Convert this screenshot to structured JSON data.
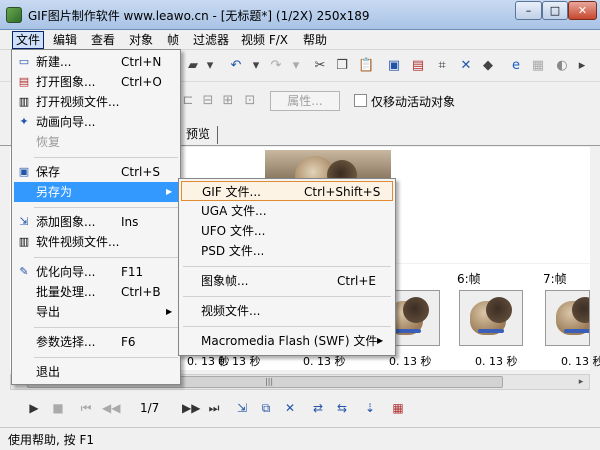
{
  "window": {
    "title": "GIF图片制作软件 www.leawo.cn - [无标题*] (1/2X)  250x189",
    "minimize": "–",
    "maximize": "□",
    "close": "✕"
  },
  "menubar": [
    "文件",
    "编辑",
    "查看",
    "对象",
    "帧",
    "过滤器",
    "视频 F/X",
    "帮助"
  ],
  "toolbar": {
    "icons": [
      "dropdown-arrow-icon",
      "undo-icon",
      "undo-dropdown-icon",
      "redo-icon",
      "redo-dropdown-icon",
      "cut-icon",
      "copy-icon",
      "paste-icon",
      "save-icon",
      "image-icon",
      "crop-icon",
      "resize-icon",
      "object-icon",
      "browser-icon",
      "disabled-icon",
      "sound-icon"
    ]
  },
  "toolbar2": {
    "properties_button": "属性...",
    "checkbox_label": "仅移动活动对象",
    "checkbox_checked": false
  },
  "tabs": {
    "preview": "预览"
  },
  "frames": {
    "labels": [
      "6:帧",
      "7:帧"
    ],
    "delays": [
      "0. 13 秒",
      "0. 13 秒",
      "0. 13 秒",
      "0. 13 秒",
      "0. 13 秒",
      "0. 13 秒",
      "0. 13 秒"
    ]
  },
  "playback": {
    "counter": "1/7"
  },
  "status": "使用帮助, 按 F1",
  "file_menu": {
    "items": [
      {
        "label": "新建...",
        "shortcut": "Ctrl+N",
        "icon": "new-icon"
      },
      {
        "label": "打开图象...",
        "shortcut": "Ctrl+O",
        "icon": "open-image-icon"
      },
      {
        "label": "打开视频文件...",
        "shortcut": "",
        "icon": "open-video-icon"
      },
      {
        "label": "动画向导...",
        "shortcut": "",
        "icon": "wizard-icon"
      },
      {
        "label": "恢复",
        "shortcut": "",
        "icon": ""
      },
      {
        "label": "保存",
        "shortcut": "Ctrl+S",
        "icon": "save-icon"
      },
      {
        "label": "另存为",
        "shortcut": "",
        "icon": ""
      },
      {
        "label": "添加图象...",
        "shortcut": "Ins",
        "icon": "add-image-icon"
      },
      {
        "label": "软件视频文件...",
        "shortcut": "",
        "icon": "video-file-icon"
      },
      {
        "label": "优化向导...",
        "shortcut": "F11",
        "icon": "optimize-icon"
      },
      {
        "label": "批量处理...",
        "shortcut": "Ctrl+B",
        "icon": ""
      },
      {
        "label": "导出",
        "shortcut": "",
        "icon": ""
      },
      {
        "label": "参数选择...",
        "shortcut": "F6",
        "icon": ""
      },
      {
        "label": "退出",
        "shortcut": "",
        "icon": ""
      }
    ]
  },
  "save_as_menu": {
    "items": [
      {
        "label": "GIF 文件...",
        "shortcut": "Ctrl+Shift+S"
      },
      {
        "label": "UGA 文件...",
        "shortcut": ""
      },
      {
        "label": "UFO 文件...",
        "shortcut": ""
      },
      {
        "label": "PSD 文件...",
        "shortcut": ""
      },
      {
        "label": "图象帧...",
        "shortcut": "Ctrl+E"
      },
      {
        "label": "视频文件...",
        "shortcut": ""
      },
      {
        "label": "Macromedia Flash (SWF) 文件",
        "shortcut": ""
      }
    ]
  },
  "colors": {
    "menu_highlight": "#3399ff",
    "submenu_highlight_border": "#e08b32"
  }
}
